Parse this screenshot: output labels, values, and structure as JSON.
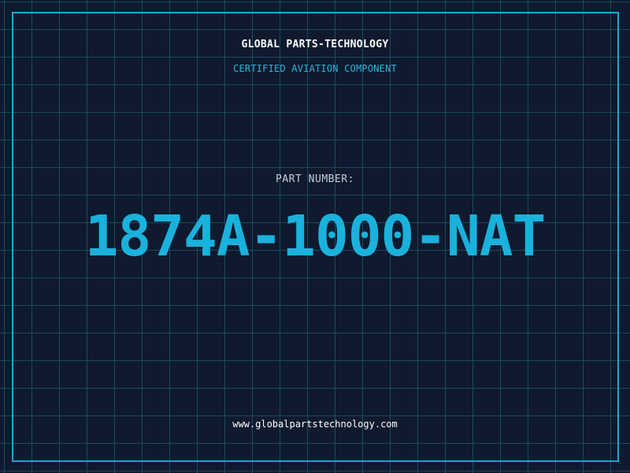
{
  "header": {
    "company": "GLOBAL PARTS-TECHNOLOGY",
    "subtitle": "CERTIFIED AVIATION COMPONENT"
  },
  "part": {
    "label": "PART NUMBER:",
    "number": "1874A-1000-NAT"
  },
  "footer": {
    "url": "www.globalpartstechnology.com"
  },
  "colors": {
    "background": "#0f1a2e",
    "grid": "#1b4a5e",
    "accent": "#17a8d0",
    "text": "#ffffff"
  }
}
